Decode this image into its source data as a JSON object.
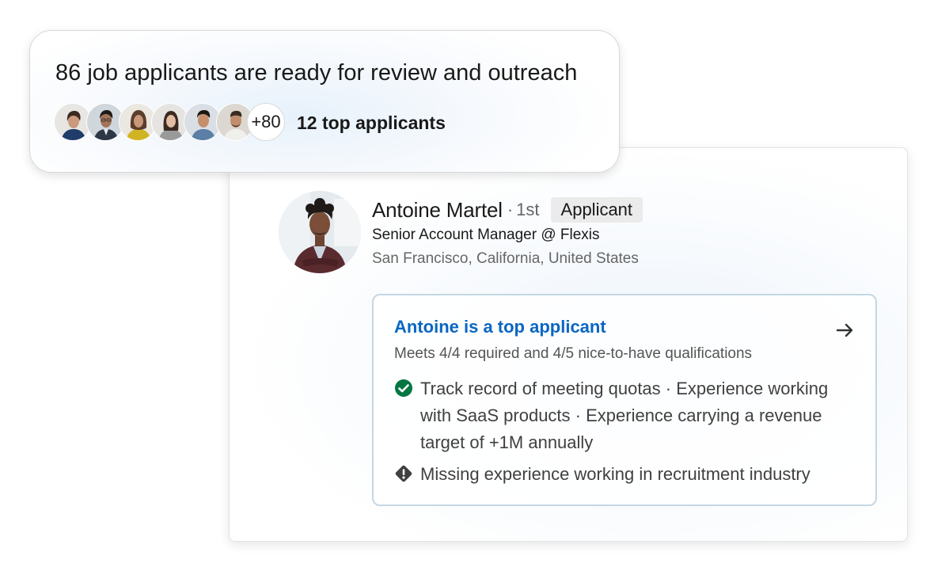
{
  "summary": {
    "title": "86 job applicants are ready for review and outreach",
    "more_count": "+80",
    "top_applicants_label": "12 top applicants"
  },
  "profile": {
    "name": "Antoine Martel",
    "separator": "·",
    "degree": "1st",
    "badge": "Applicant",
    "headline": "Senior Account Manager @ Flexis",
    "location": "San Francisco, California, United States"
  },
  "insight": {
    "title": "Antoine is a top applicant",
    "subtitle": "Meets 4/4 required and 4/5 nice-to-have qualifications",
    "met_text": "Track record of meeting quotas · Experience working with SaaS products · Experience carrying a revenue target of +1M annually",
    "missing_text": "Missing experience working in recruitment industry"
  },
  "colors": {
    "accent_blue": "#0a66c2",
    "check_green": "#057642",
    "warning_dark": "#404040"
  },
  "icons": {
    "arrow": "arrow-right-icon",
    "met": "check-circle-icon",
    "missing": "warning-diamond-icon"
  }
}
